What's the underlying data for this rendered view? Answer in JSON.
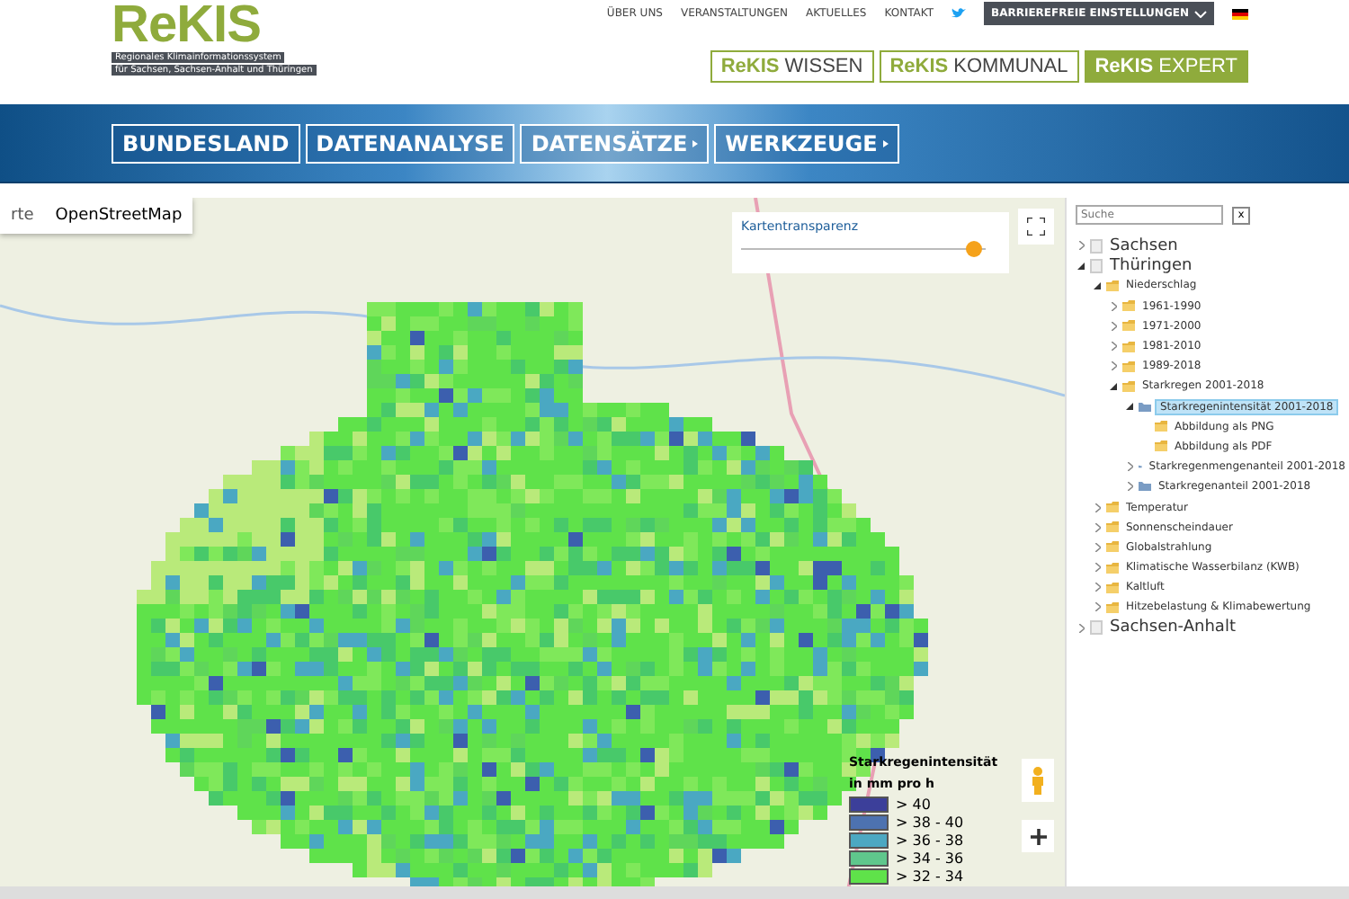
{
  "header": {
    "logo": "ReKIS",
    "tagline": [
      "Regionales Klimainformationssystem",
      "für Sachsen, Sachsen-Anhalt und Thüringen"
    ],
    "top_links": [
      "ÜBER UNS",
      "VERANSTALTUNGEN",
      "AKTUELLES",
      "KONTAKT"
    ],
    "accessibility_button": "BARRIEREFREIE EINSTELLUNGEN",
    "products": [
      {
        "label": "**ReKIS** WISSEN",
        "selected": false
      },
      {
        "label": "**ReKIS** KOMMUNAL",
        "selected": false
      },
      {
        "label": "**ReKIS** EXPERT",
        "selected": true
      }
    ]
  },
  "main_nav": [
    {
      "label": "BUNDESLAND",
      "submenu": false
    },
    {
      "label": "DATENANALYSE",
      "submenu": false
    },
    {
      "label": "DATENSÄTZE",
      "submenu": true
    },
    {
      "label": "WERKZEUGE",
      "submenu": true
    }
  ],
  "map": {
    "base_layers": [
      {
        "label": "rte",
        "selected": false
      },
      {
        "label": "OpenStreetMap",
        "selected": true
      }
    ],
    "transparency": {
      "label": "Kartentransparenz",
      "level": 0.95
    },
    "legend": {
      "title": "Starkregenintensität",
      "unit": "in mm pro h",
      "items": [
        {
          "label": "> 40",
          "color": "#3c3f9a"
        },
        {
          "label": "> 38 - 40",
          "color": "#4d72b0"
        },
        {
          "label": "> 36 - 38",
          "color": "#4ca8c2"
        },
        {
          "label": "> 34 - 36",
          "color": "#5fc78c"
        },
        {
          "label": "> 32 - 34",
          "color": "#5fe24a"
        }
      ]
    }
  },
  "sidebar": {
    "search": {
      "placeholder": "Suche",
      "clear": "x"
    },
    "tree": [
      {
        "label": "Sachsen",
        "kind": "region",
        "expanded": false,
        "selected": false
      },
      {
        "label": "Thüringen",
        "kind": "region",
        "expanded": true,
        "selected": false,
        "children": [
          {
            "label": "Niederschlag",
            "kind": "folder",
            "expanded": true,
            "selected": false,
            "children": [
              {
                "label": "1961-1990",
                "kind": "folder",
                "expanded": false,
                "selected": false
              },
              {
                "label": "1971-2000",
                "kind": "folder",
                "expanded": false,
                "selected": false
              },
              {
                "label": "1981-2010",
                "kind": "folder",
                "expanded": false,
                "selected": false
              },
              {
                "label": "1989-2018",
                "kind": "folder",
                "expanded": false,
                "selected": false
              },
              {
                "label": "Starkregen 2001-2018",
                "kind": "folder",
                "expanded": true,
                "selected": false,
                "children": [
                  {
                    "label": "Starkregenintensität 2001-2018",
                    "kind": "layer",
                    "expanded": true,
                    "selected": true,
                    "children": [
                      {
                        "label": "Abbildung als PNG",
                        "kind": "folder",
                        "selected": false
                      },
                      {
                        "label": "Abbildung als PDF",
                        "kind": "folder",
                        "selected": false
                      }
                    ]
                  },
                  {
                    "label": "Starkregenmengenanteil 2001-2018",
                    "kind": "layer",
                    "expanded": false,
                    "selected": false
                  },
                  {
                    "label": "Starkregenanteil 2001-2018",
                    "kind": "layer",
                    "expanded": false,
                    "selected": false
                  }
                ]
              }
            ]
          },
          {
            "label": "Temperatur",
            "kind": "folder",
            "expanded": false,
            "selected": false
          },
          {
            "label": "Sonnenscheindauer",
            "kind": "folder",
            "expanded": false,
            "selected": false
          },
          {
            "label": "Globalstrahlung",
            "kind": "folder",
            "expanded": false,
            "selected": false
          },
          {
            "label": "Klimatische Wasserbilanz (KWB)",
            "kind": "folder",
            "expanded": false,
            "selected": false
          },
          {
            "label": "Kaltluft",
            "kind": "folder",
            "expanded": false,
            "selected": false
          },
          {
            "label": "Hitzebelastung & Klimabewertung",
            "kind": "folder",
            "expanded": false,
            "selected": false
          }
        ]
      },
      {
        "label": "Sachsen-Anhalt",
        "kind": "region",
        "expanded": false,
        "selected": false
      }
    ]
  }
}
